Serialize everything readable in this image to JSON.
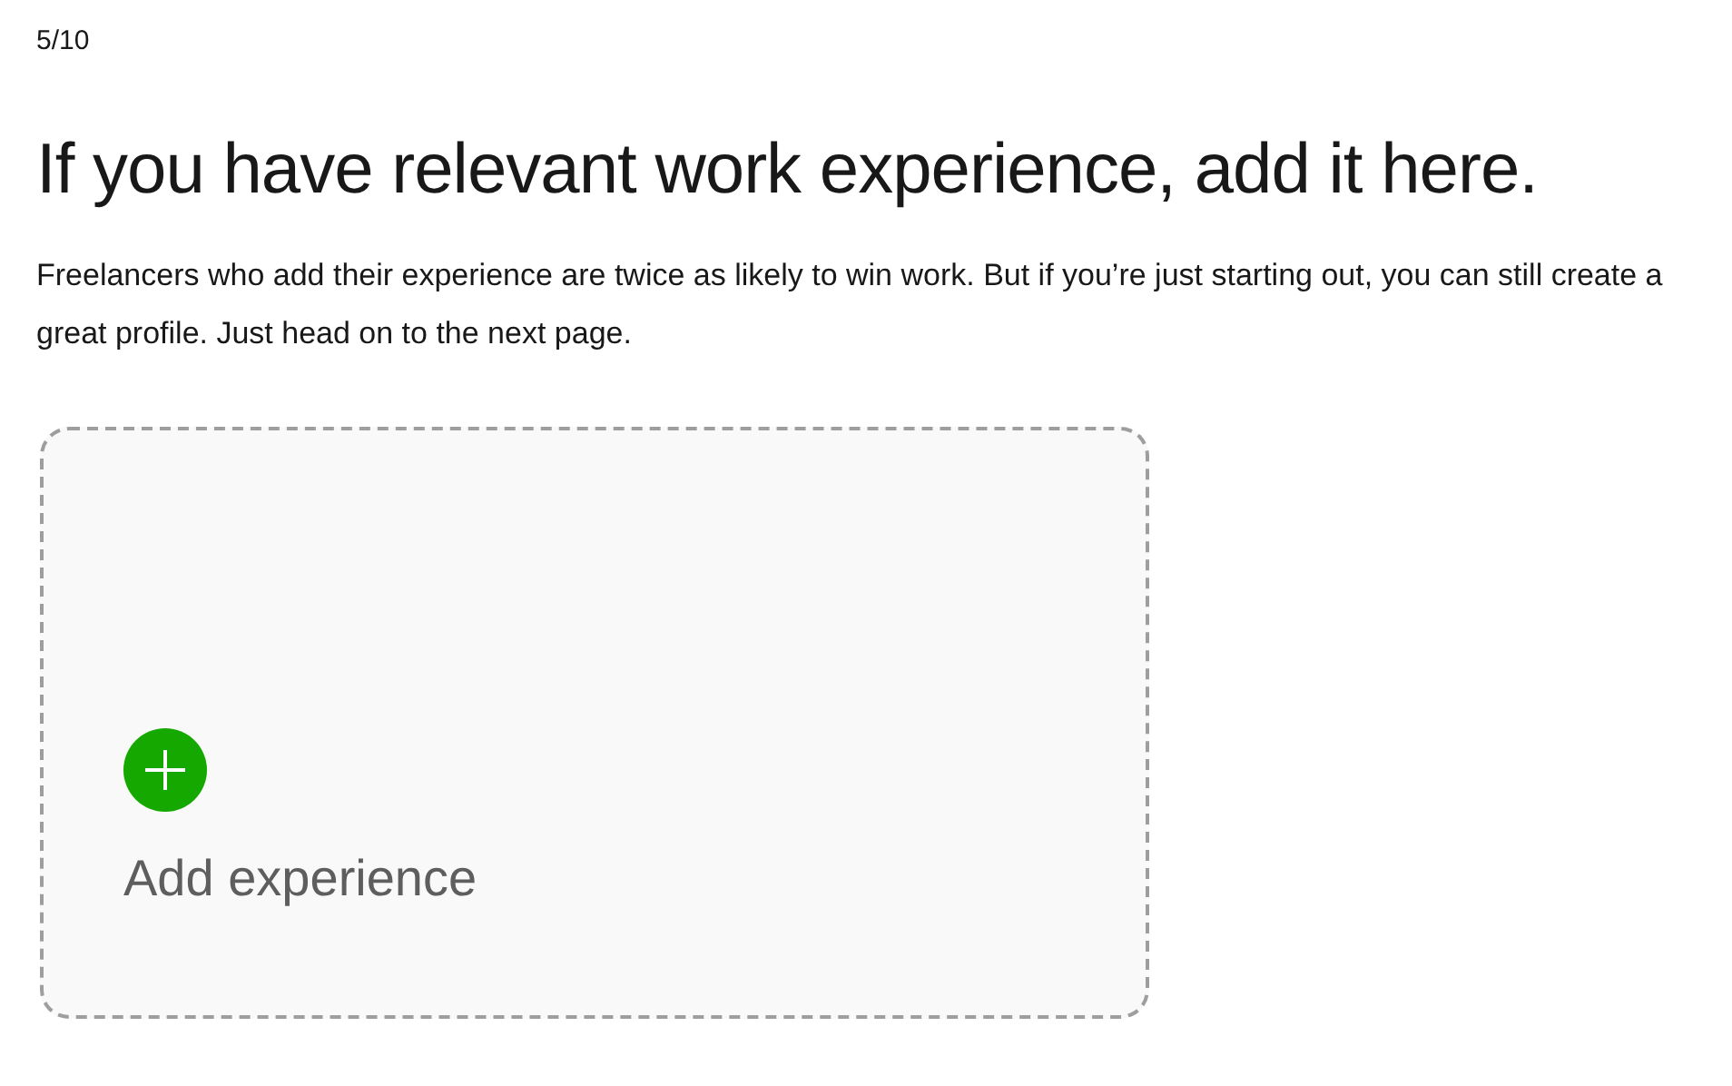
{
  "step": "5/10",
  "heading": "If you have relevant work experience, add it here.",
  "description": "Freelancers who add their experience are twice as likely to win work. But if you’re just starting out, you can still create a great profile. Just head on to the next page.",
  "add_card": {
    "label": "Add experience"
  }
}
